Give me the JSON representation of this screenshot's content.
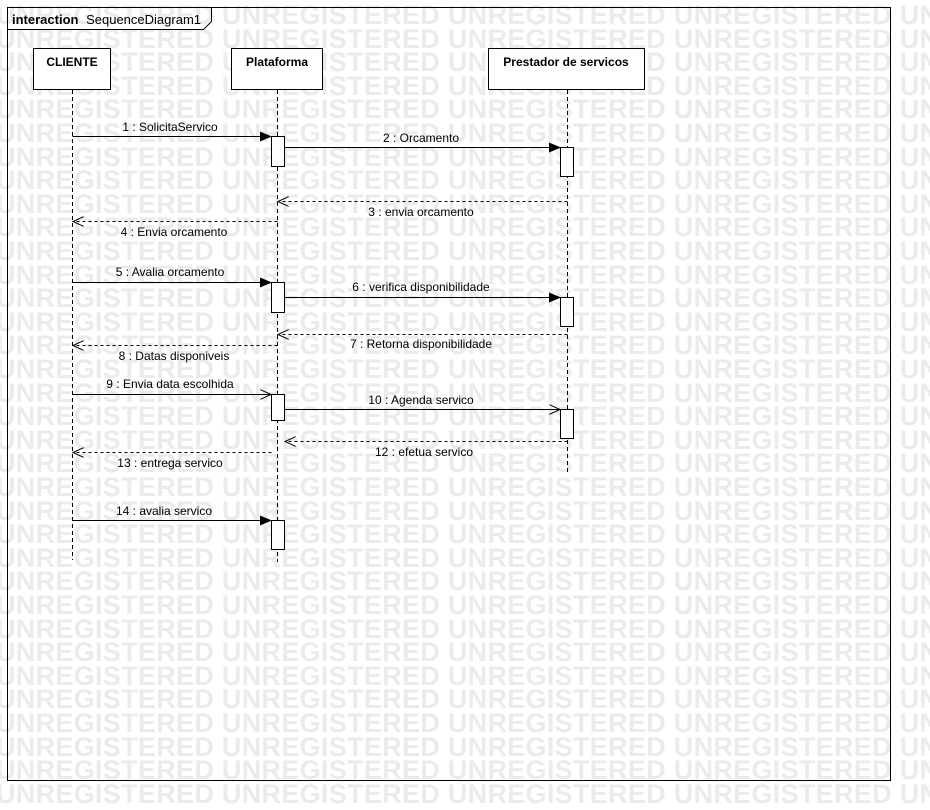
{
  "frame": {
    "keyword": "interaction",
    "name": "SequenceDiagram1"
  },
  "watermark": {
    "text": "UNREGISTERED"
  },
  "lifelines": [
    {
      "id": "cliente",
      "label": "CLIENTE"
    },
    {
      "id": "plataforma",
      "label": "Plataforma"
    },
    {
      "id": "prestador",
      "label": "Prestador de servicos"
    }
  ],
  "messages": [
    {
      "label": "1 : SolicitaServico",
      "from": "cliente",
      "to": "plataforma",
      "kind": "sync"
    },
    {
      "label": "2 : Orcamento",
      "from": "plataforma",
      "to": "prestador",
      "kind": "sync"
    },
    {
      "label": "3 : envia orcamento",
      "from": "prestador",
      "to": "plataforma",
      "kind": "reply"
    },
    {
      "label": "4 : Envia orcamento",
      "from": "plataforma",
      "to": "cliente",
      "kind": "reply"
    },
    {
      "label": "5 : Avalia orcamento",
      "from": "cliente",
      "to": "plataforma",
      "kind": "sync"
    },
    {
      "label": "6 : verifica disponibilidade",
      "from": "plataforma",
      "to": "prestador",
      "kind": "sync"
    },
    {
      "label": "7 : Retorna disponibilidade",
      "from": "prestador",
      "to": "plataforma",
      "kind": "reply"
    },
    {
      "label": "8 : Datas disponiveis",
      "from": "plataforma",
      "to": "cliente",
      "kind": "reply"
    },
    {
      "label": "9 : Envia data escolhida",
      "from": "cliente",
      "to": "plataforma",
      "kind": "sync"
    },
    {
      "label": "10 : Agenda servico",
      "from": "plataforma",
      "to": "prestador",
      "kind": "sync"
    },
    {
      "label": "12 : efetua servico",
      "from": "prestador",
      "to": "plataforma",
      "kind": "reply"
    },
    {
      "label": "13 : entrega servico",
      "from": "plataforma",
      "to": "cliente",
      "kind": "reply"
    },
    {
      "label": "14 : avalia servico",
      "from": "cliente",
      "to": "plataforma",
      "kind": "sync"
    }
  ]
}
